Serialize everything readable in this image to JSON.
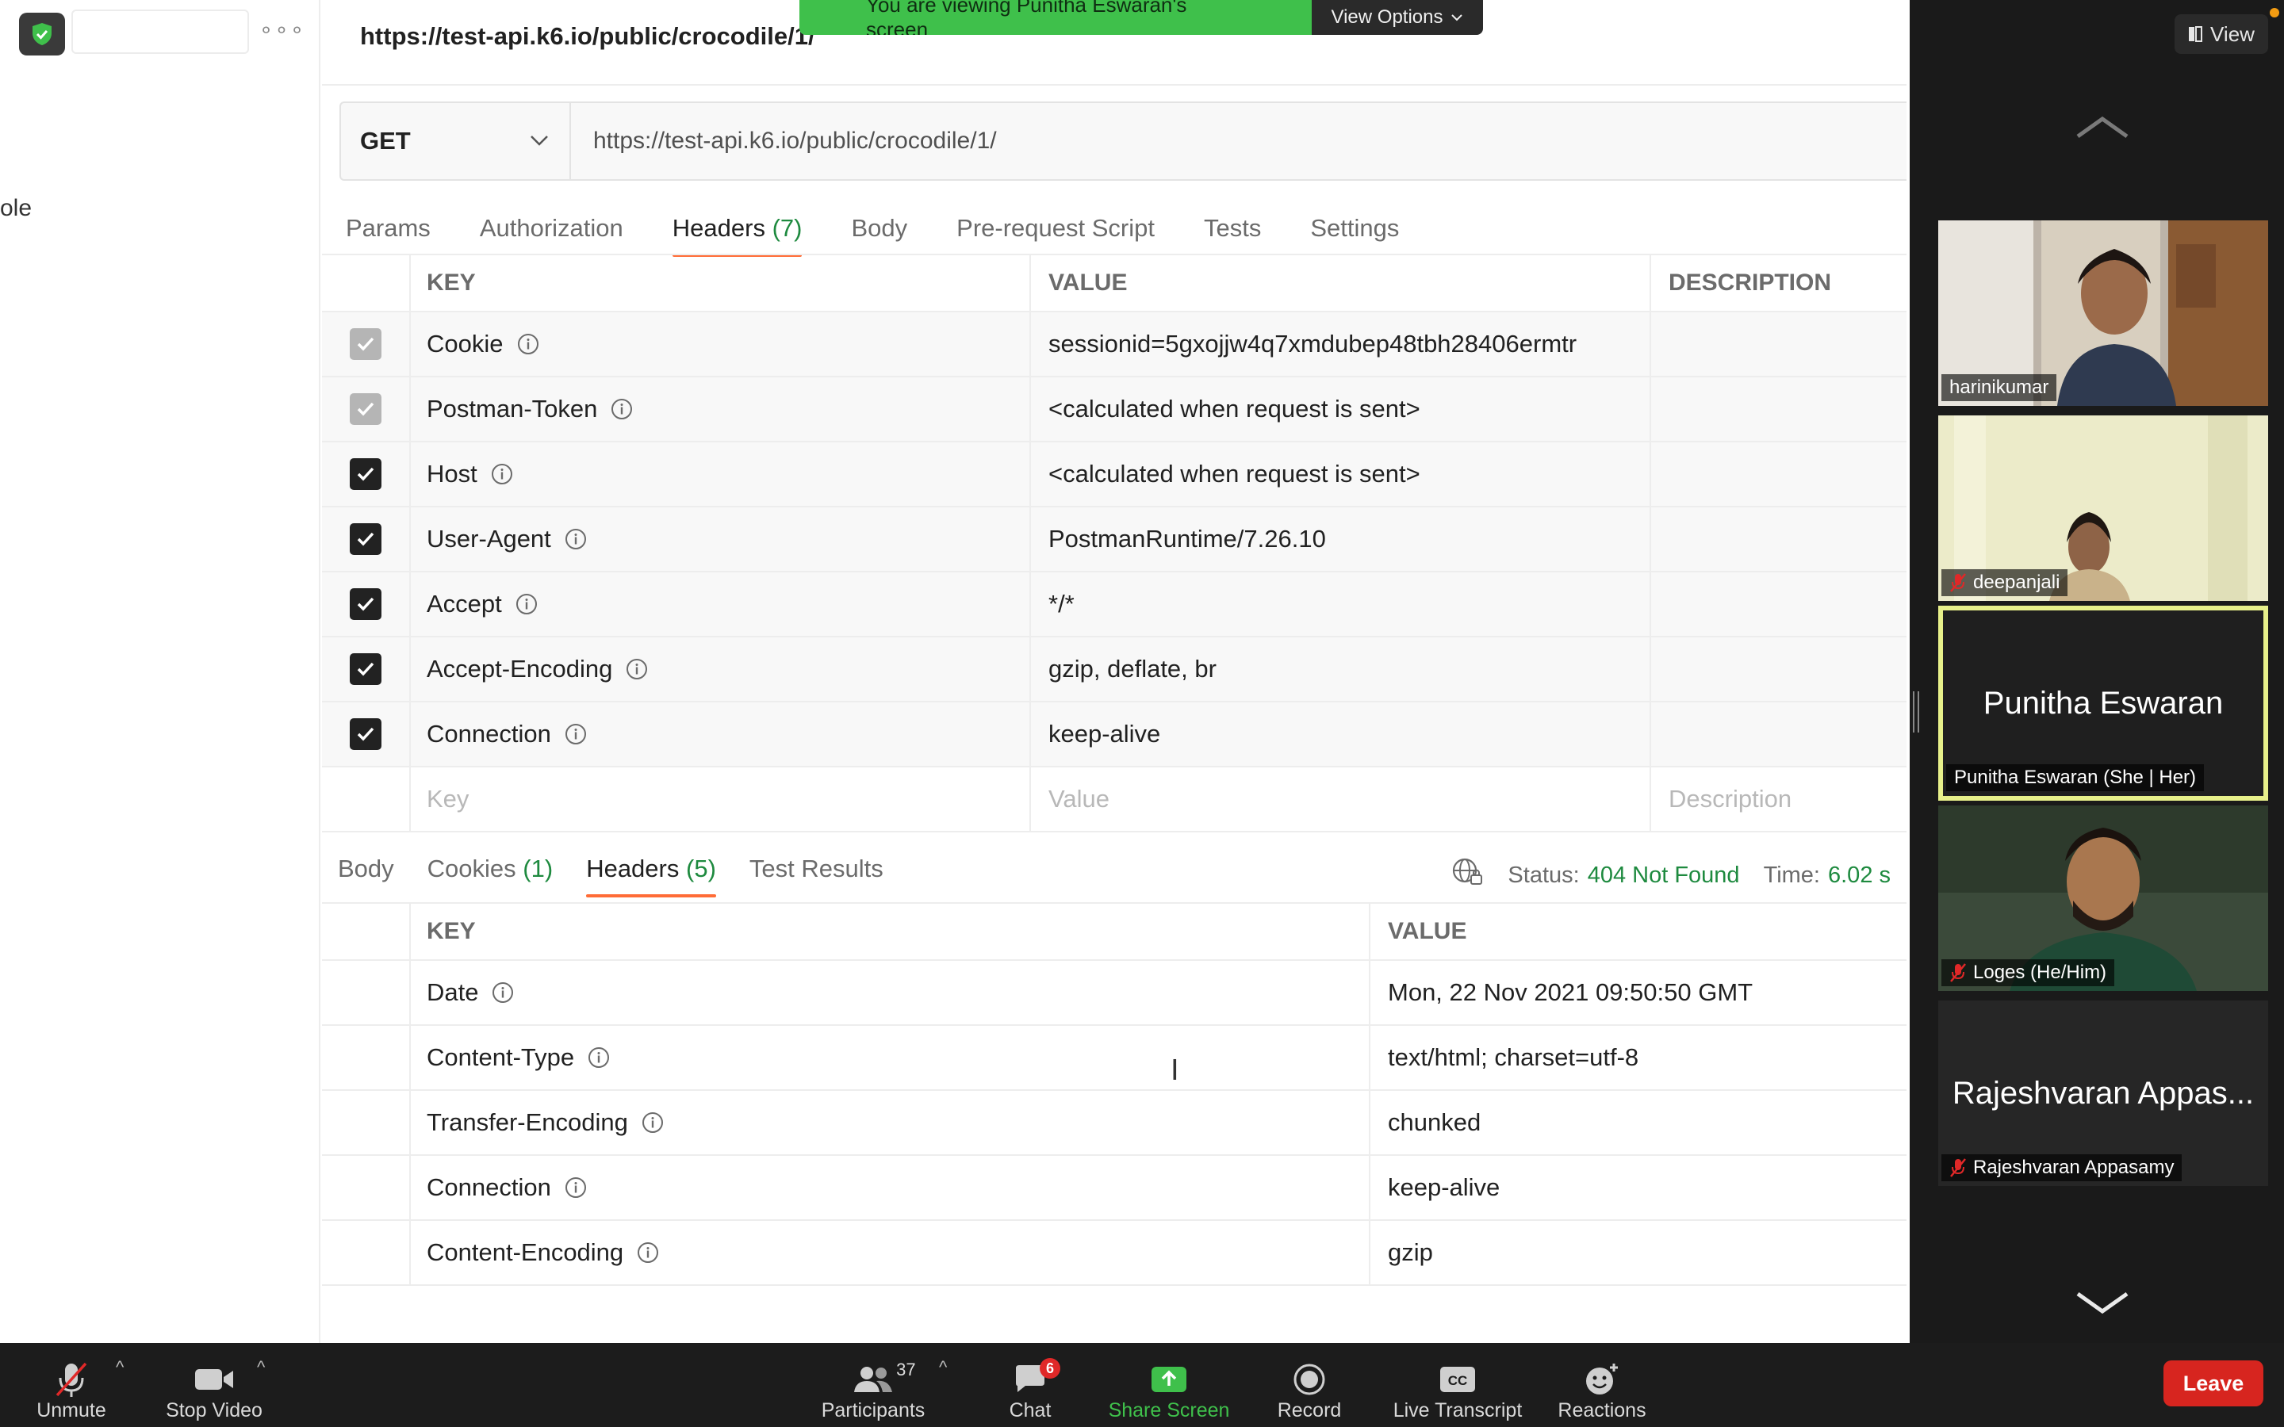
{
  "sidebar": {
    "partial_text": "ole"
  },
  "request": {
    "tab_title": "https://test-api.k6.io/public/crocodile/1/",
    "method": "GET",
    "url": "https://test-api.k6.io/public/crocodile/1/",
    "tabs": [
      {
        "label": "Params",
        "count": ""
      },
      {
        "label": "Authorization",
        "count": ""
      },
      {
        "label": "Headers",
        "count": "(7)"
      },
      {
        "label": "Body",
        "count": ""
      },
      {
        "label": "Pre-request Script",
        "count": ""
      },
      {
        "label": "Tests",
        "count": ""
      },
      {
        "label": "Settings",
        "count": ""
      }
    ],
    "table_headers": {
      "key": "KEY",
      "value": "VALUE",
      "description": "DESCRIPTION"
    },
    "headers": [
      {
        "key": "Cookie",
        "value": "sessionid=5gxojjw4q7xmdubep48tbh28406ermtr",
        "checked": true,
        "disabled": true
      },
      {
        "key": "Postman-Token",
        "value": "<calculated when request is sent>",
        "checked": true,
        "disabled": true
      },
      {
        "key": "Host",
        "value": "<calculated when request is sent>",
        "checked": true,
        "disabled": false
      },
      {
        "key": "User-Agent",
        "value": "PostmanRuntime/7.26.10",
        "checked": true,
        "disabled": false
      },
      {
        "key": "Accept",
        "value": "*/*",
        "checked": true,
        "disabled": false
      },
      {
        "key": "Accept-Encoding",
        "value": "gzip, deflate, br",
        "checked": true,
        "disabled": false
      },
      {
        "key": "Connection",
        "value": "keep-alive",
        "checked": true,
        "disabled": false
      }
    ],
    "new_row_placeholders": {
      "key": "Key",
      "value": "Value",
      "description": "Description"
    }
  },
  "response": {
    "tabs": [
      {
        "label": "Body",
        "count": ""
      },
      {
        "label": "Cookies",
        "count": "(1)"
      },
      {
        "label": "Headers",
        "count": "(5)"
      },
      {
        "label": "Test Results",
        "count": ""
      }
    ],
    "status_label": "Status:",
    "status_value": "404 Not Found",
    "time_label": "Time:",
    "time_value": "6.02 s",
    "table_headers": {
      "key": "KEY",
      "value": "VALUE"
    },
    "headers": [
      {
        "key": "Date",
        "value": "Mon, 22 Nov 2021 09:50:50 GMT"
      },
      {
        "key": "Content-Type",
        "value": "text/html; charset=utf-8"
      },
      {
        "key": "Transfer-Encoding",
        "value": "chunked"
      },
      {
        "key": "Connection",
        "value": "keep-alive"
      },
      {
        "key": "Content-Encoding",
        "value": "gzip"
      }
    ]
  },
  "share_banner": {
    "text": "You are viewing Punitha Eswaran's screen",
    "view_options": "View Options"
  },
  "participants_panel": {
    "view_label": "View",
    "tiles": [
      {
        "name": "harinikumar",
        "muted": false,
        "big_name": ""
      },
      {
        "name": "deepanjali",
        "muted": true,
        "big_name": ""
      },
      {
        "name": "Punitha Eswaran  (She | Her)",
        "muted": false,
        "big_name": "Punitha Eswaran"
      },
      {
        "name": "Loges  (He/Him)",
        "muted": true,
        "big_name": ""
      },
      {
        "name": "Rajeshvaran Appasamy",
        "muted": true,
        "big_name": "Rajeshvaran Appas..."
      }
    ]
  },
  "toolbar": {
    "unmute": "Unmute",
    "stop_video": "Stop Video",
    "participants": "Participants",
    "participants_count": "37",
    "chat": "Chat",
    "chat_badge": "6",
    "share_screen": "Share Screen",
    "record": "Record",
    "live_transcript": "Live Transcript",
    "reactions": "Reactions",
    "leave": "Leave"
  },
  "colors": {
    "accent_tab": "#ff6c37",
    "count_green": "#1e8a3f",
    "share_green": "#3fc04b",
    "leave_red": "#d7251f",
    "active_speaker": "#e7f08a"
  }
}
